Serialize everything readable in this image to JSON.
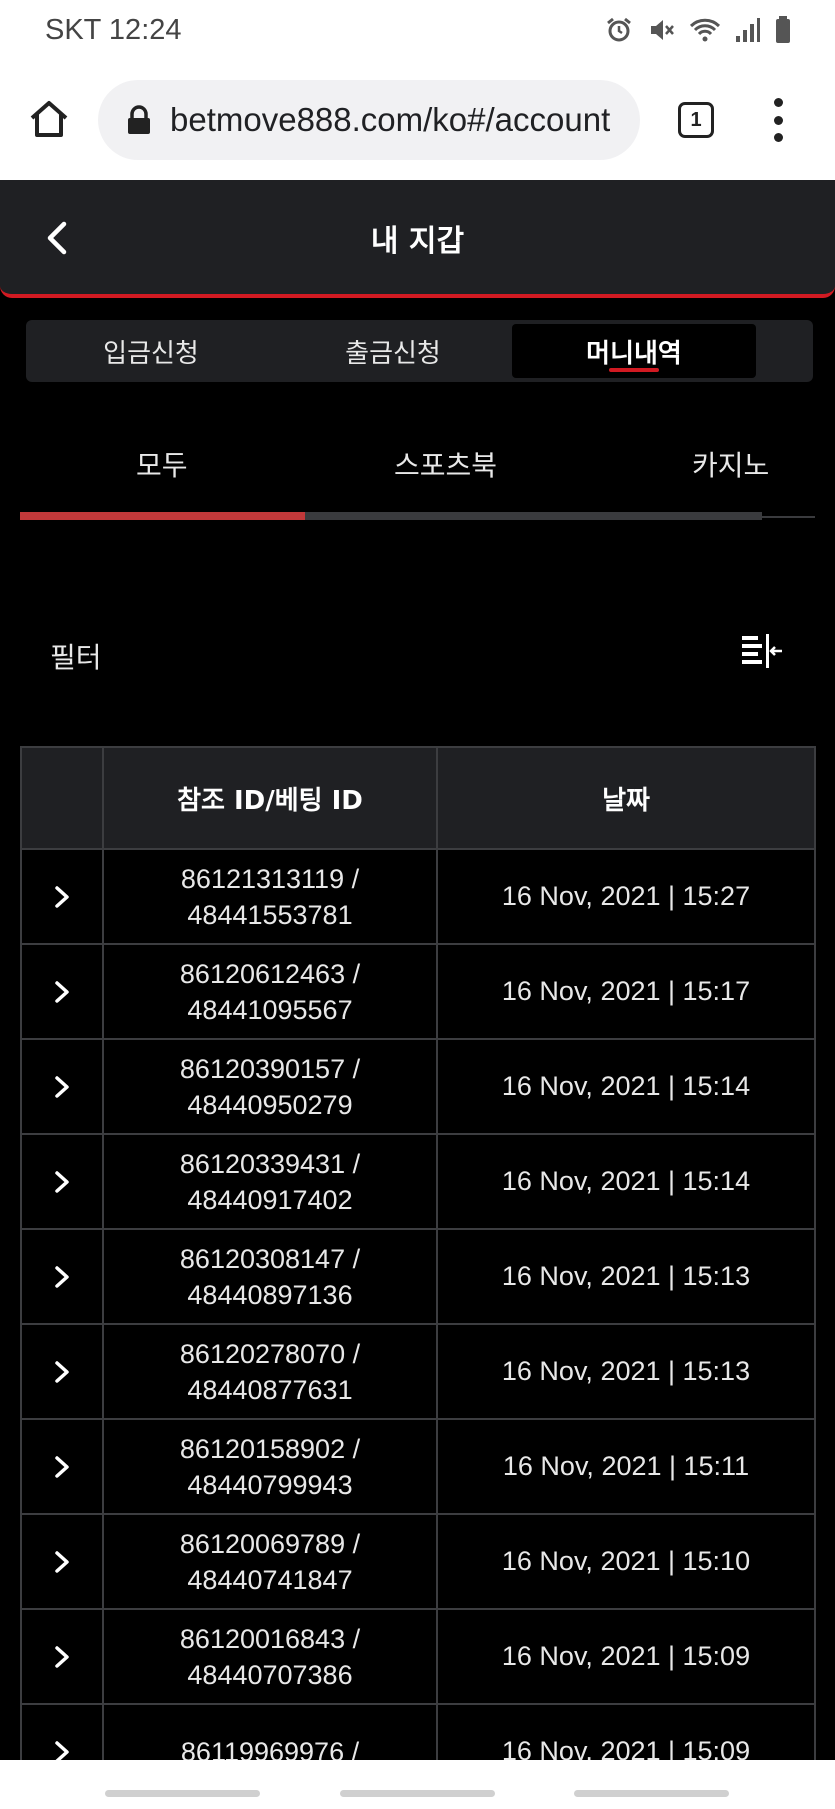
{
  "status_bar": {
    "carrier_time": "SKT 12:24"
  },
  "browser": {
    "url": "betmove888.com/ko#/account",
    "tab_count": "1"
  },
  "header": {
    "title": "내 지갑"
  },
  "main_tabs": [
    {
      "label": "입금신청",
      "active": false
    },
    {
      "label": "출금신청",
      "active": false
    },
    {
      "label": "머니내역",
      "active": true
    }
  ],
  "sub_tabs": [
    {
      "label": "모두",
      "active": true
    },
    {
      "label": "스포츠북",
      "active": false
    },
    {
      "label": "카지노",
      "active": false
    }
  ],
  "filter": {
    "label": "필터"
  },
  "table": {
    "headers": [
      "",
      "참조 ID/베팅 ID",
      "날짜"
    ],
    "rows": [
      {
        "ref_id": "86121313119 /",
        "bet_id": "48441553781",
        "date": "16 Nov, 2021 | 15:27"
      },
      {
        "ref_id": "86120612463 /",
        "bet_id": "48441095567",
        "date": "16 Nov, 2021 | 15:17"
      },
      {
        "ref_id": "86120390157 /",
        "bet_id": "48440950279",
        "date": "16 Nov, 2021 | 15:14"
      },
      {
        "ref_id": "86120339431 /",
        "bet_id": "48440917402",
        "date": "16 Nov, 2021 | 15:14"
      },
      {
        "ref_id": "86120308147 /",
        "bet_id": "48440897136",
        "date": "16 Nov, 2021 | 15:13"
      },
      {
        "ref_id": "86120278070 /",
        "bet_id": "48440877631",
        "date": "16 Nov, 2021 | 15:13"
      },
      {
        "ref_id": "86120158902 /",
        "bet_id": "48440799943",
        "date": "16 Nov, 2021 | 15:11"
      },
      {
        "ref_id": "86120069789 /",
        "bet_id": "48440741847",
        "date": "16 Nov, 2021 | 15:10"
      },
      {
        "ref_id": "86120016843 /",
        "bet_id": "48440707386",
        "date": "16 Nov, 2021 | 15:09"
      },
      {
        "ref_id": "86119969976 /",
        "bet_id": "",
        "date": "16 Nov, 2021 | 15:09"
      }
    ]
  },
  "colors": {
    "accent": "#d11a22",
    "panel": "#1f2023",
    "background": "#000000"
  },
  "icons": [
    "home-icon",
    "lock-icon",
    "tabs-icon",
    "more-vert-icon",
    "back-arrow-icon",
    "filter-icon",
    "chevron-right-icon"
  ]
}
